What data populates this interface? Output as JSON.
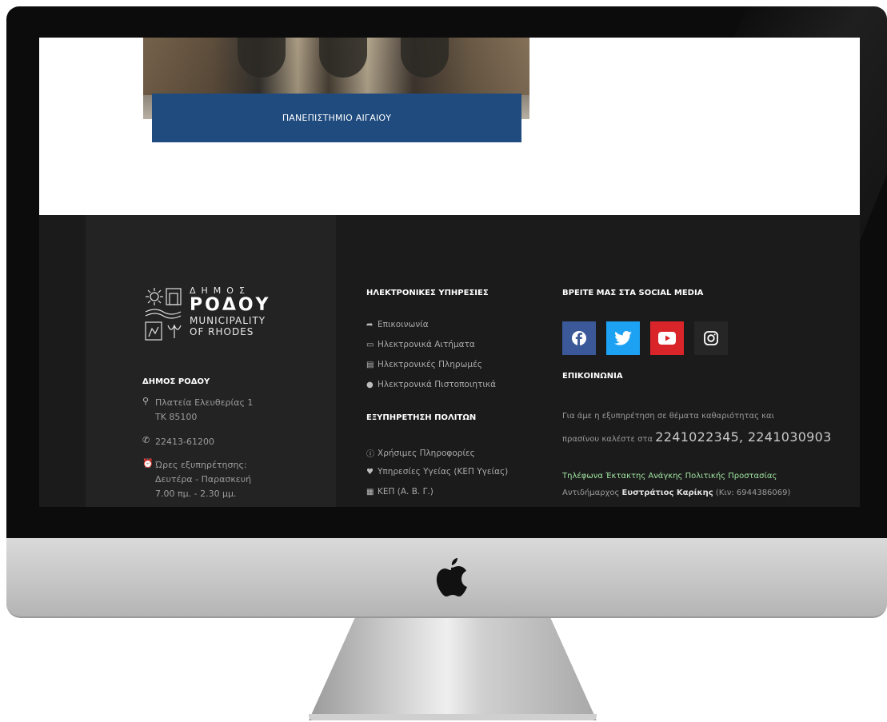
{
  "hero": {
    "caption": "ΠΑΝΕΠΙΣΤΗΜΙΟ ΑΙΓΑΙΟΥ"
  },
  "logo": {
    "line1": "ΔΗΜΟΣ",
    "line2": "ΡΟΔΟΥ",
    "line3": "MUNICIPALITY",
    "line4": "OF RHODES"
  },
  "municipality": {
    "title": "ΔΗΜΟΣ ΡΟΔΟΥ",
    "address_line1": "Πλατεία Ελευθερίας 1",
    "address_line2": "ΤΚ 85100",
    "phone": "22413-61200",
    "hours_label": "Ώρες εξυπηρέτησης:",
    "hours_days": "Δευτέρα - Παρασκευή",
    "hours_time": "7.00 πμ. - 2.30 μμ."
  },
  "electronic_services": {
    "title": "ΗΛΕΚΤΡΟΝΙΚΕΣ ΥΠΗΡΕΣΙΕΣ",
    "items": [
      {
        "label": "Επικοινωνία",
        "icon": "share-icon"
      },
      {
        "label": "Ηλεκτρονικά Αιτήματα",
        "icon": "monitor-icon"
      },
      {
        "label": "Ηλεκτρονικές Πληρωμές",
        "icon": "credit-card-icon"
      },
      {
        "label": "Ηλεκτρονικά Πιστοποιητικά",
        "icon": "dot-icon"
      }
    ]
  },
  "citizen_services": {
    "title": "ΕΞΥΠΗΡΕΤΗΣΗ ΠΟΛΙΤΩΝ",
    "items": [
      {
        "label": "Χρήσιμες Πληροφορίες",
        "icon": "info-icon"
      },
      {
        "label": "Υπηρεσίες Υγείας (ΚΕΠ Υγείας)",
        "icon": "heartbeat-icon"
      },
      {
        "label": "ΚΕΠ (Α. Β. Γ.)",
        "icon": "book-icon"
      }
    ]
  },
  "social": {
    "title": "ΒΡΕΙΤΕ ΜΑΣ ΣΤΑ SOCIAL MEDIA",
    "facebook_color": "#3b5998",
    "twitter_color": "#1da1f2",
    "youtube_color": "#d9252a",
    "instagram_color": "#262626"
  },
  "contact": {
    "title": "ΕΠΙΚΟΙΝΩΝΙΑ",
    "text_line1": "Για άμε   η εξυπηρέτηση σε θέματα καθαριότητας και",
    "text_line2": "πρασίνου καλέστε στα",
    "phones": "2241022345, 2241030903",
    "emergency": "Τηλέφωνα Έκτακτης Ανάγκης Πολιτικής Προστασίας",
    "deputy_prefix": "Αντιδήμαρχος",
    "deputy_name": "Ευστράτιος Καρίκης",
    "deputy_mobile": "(Κιν: 6944386069)"
  }
}
